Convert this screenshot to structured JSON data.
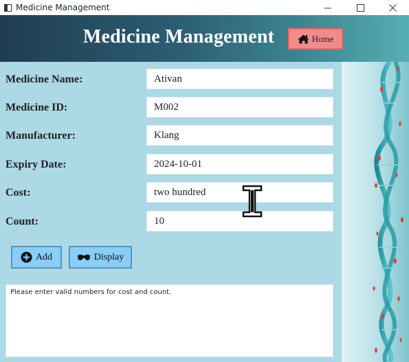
{
  "window": {
    "title": "Medicine Management",
    "controls": [
      "minimize-icon",
      "maximize-icon",
      "close-icon"
    ]
  },
  "header": {
    "title": "Medicine Management",
    "home_label": "Home",
    "home_icon": "home-icon",
    "colors": {
      "gradient_start": "#1f3d52",
      "gradient_end": "#57aeb4",
      "home_bg": "#f28b8b"
    }
  },
  "form": {
    "background": "#add8e6",
    "fields": [
      {
        "label": "Medicine Name:",
        "value": "Ativan"
      },
      {
        "label": "Medicine ID:",
        "value": "M002"
      },
      {
        "label": "Manufacturer:",
        "value": "Klang"
      },
      {
        "label": "Expiry Date:",
        "value": "2024-10-01"
      },
      {
        "label": "Cost:",
        "value": "two hundred"
      },
      {
        "label": "Count:",
        "value": "10"
      }
    ],
    "buttons": {
      "add_label": "Add",
      "add_icon": "plus-circle-icon",
      "display_label": "Display",
      "display_icon": "glasses-icon",
      "button_color": "#87cefa"
    },
    "message": "Please enter valid numbers for cost and count."
  },
  "side_image": {
    "icon": "dna-helix-icon"
  }
}
